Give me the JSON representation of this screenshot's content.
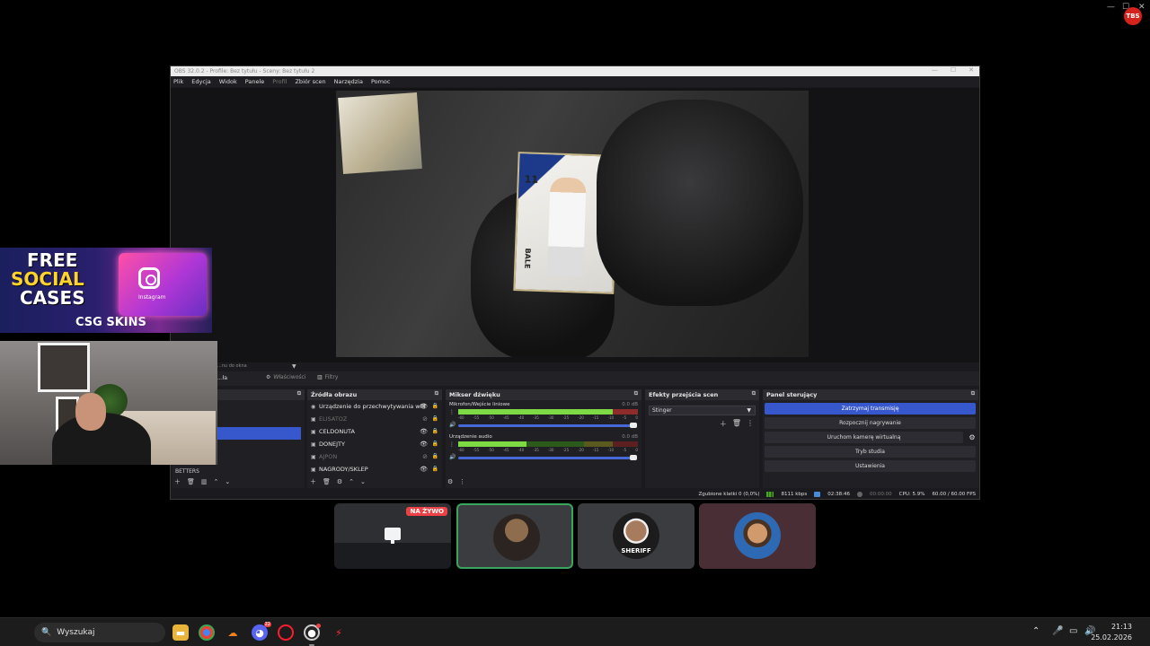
{
  "colors": {
    "obs_selection": "#3757cc",
    "live_badge": "#ed4245",
    "speaking_border": "#3ba55d",
    "meter_green": "#46a820"
  },
  "obs": {
    "window_title": "OBS 32.0.2 - Profile: Bez tytułu - Sceny: Bez tytułu 2",
    "menu": [
      "Plik",
      "Edycja",
      "Widok",
      "Panele",
      "Profil",
      "Zbiór scen",
      "Narzędzia",
      "Pomoc"
    ],
    "preview_card_number": "11",
    "preview_card_name": "BALE",
    "tool_row_text": "...nu do okna",
    "props_button": "Właściwości",
    "filters_button": "Filtry",
    "props_left": "...ła",
    "docks": {
      "sources_title": "Źródła obrazu",
      "mixer_title": "Mikser dźwięku",
      "transitions_title": "Efekty przejścia scen",
      "controls_title": "Panel sterujący"
    },
    "scene_bottom_label": "BETTERS",
    "sources": [
      {
        "label": "Urządzenie do przechwytywania wid",
        "icon": "camera-icon",
        "visible": true
      },
      {
        "label": "ELISATOZ",
        "icon": "image-icon",
        "visible": false
      },
      {
        "label": "CELDONUTA",
        "icon": "image-icon",
        "visible": true
      },
      {
        "label": "DONEJTY",
        "icon": "image-icon",
        "visible": true
      },
      {
        "label": "AJPON",
        "icon": "image-icon",
        "visible": false
      },
      {
        "label": "NAGRODY/SKLEP",
        "icon": "image-icon",
        "visible": false
      }
    ],
    "mixer": [
      {
        "name": "Mikrofon/Wejście liniowe",
        "db": "0.0 dB",
        "level": 0.86
      },
      {
        "name": "Urządzenie audio",
        "db": "0.0 dB",
        "level": 0.38
      }
    ],
    "meter_ticks": [
      "-60",
      "-55",
      "-50",
      "-45",
      "-40",
      "-35",
      "-30",
      "-25",
      "-20",
      "-15",
      "-10",
      "-5",
      "0"
    ],
    "transition_value": "Stinger",
    "controls": {
      "stop_stream": "Zatrzymaj transmisję",
      "start_recording": "Rozpocznij nagrywanie",
      "virtual_cam": "Uruchom kamerę wirtualną",
      "studio_mode": "Tryb studia",
      "settings": "Ustawienia"
    },
    "status": {
      "dropped_frames": "Zgubione klatki 0 (0,0%)",
      "bitrate": "8111 kbps",
      "live_time": "02:38:46",
      "rec_time": "00:00:00",
      "cpu": "CPU: 5.9%",
      "fps": "60.00 / 60.00 FPS"
    }
  },
  "overlay": {
    "promo_line1": "FREE",
    "promo_line2": "SOCIAL",
    "promo_line3": "CASES",
    "promo_brand": "CSG SKINS",
    "chest_label": "Instagram"
  },
  "call": {
    "live_badge": "NA ŻYWO",
    "sheriff_label": "SHERIFF"
  },
  "taskbar": {
    "search_placeholder": "Wyszukaj",
    "time": "21:13",
    "date": "25.02.2026",
    "discord_badge": "22"
  }
}
